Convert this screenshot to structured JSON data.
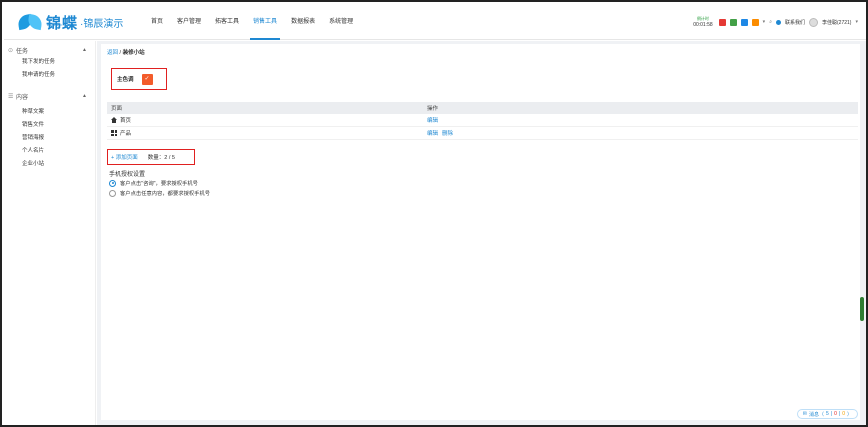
{
  "brand": {
    "name": "锦蝶",
    "suffix": "·锦辰演示",
    "url": "BEESM.COM"
  },
  "nav": [
    {
      "label": "首页",
      "active": false
    },
    {
      "label": "客户管理",
      "active": false
    },
    {
      "label": "拓客工具",
      "active": false
    },
    {
      "label": "销售工具",
      "active": true
    },
    {
      "label": "数据报表",
      "active": false
    },
    {
      "label": "系统管理",
      "active": false
    }
  ],
  "topright": {
    "timer_label": "倒计时",
    "timer_value": "00:01:58",
    "icons": [
      "red-square-icon",
      "green-square-icon",
      "blue-square-icon",
      "orange-square-icon"
    ],
    "contact": "联系我们",
    "user": "李佳聪(2721)"
  },
  "sidebar": {
    "groups": [
      {
        "label": "任务",
        "icon": "clock-icon",
        "items": [
          "我下发的任务",
          "我申请的任务"
        ]
      },
      {
        "label": "内容",
        "icon": "list-icon",
        "items": [
          "种草文案",
          "销售文件",
          "营销海报",
          "个人名片",
          "企业小站"
        ]
      }
    ]
  },
  "breadcrumb": {
    "link": "返回",
    "sep": " / ",
    "current": "装修小站"
  },
  "theme": {
    "label": "主色调",
    "color": "#f35c2b",
    "mark": "✓"
  },
  "table": {
    "headers": [
      "页面",
      "操作"
    ],
    "rows": [
      {
        "name": "首页",
        "icon": "home-icon",
        "ops": [
          "编辑"
        ]
      },
      {
        "name": "产品",
        "icon": "grid-icon",
        "ops": [
          "编辑",
          "删除"
        ]
      }
    ]
  },
  "add": {
    "label": "+ 添加页面",
    "count": "数量：2 / 5"
  },
  "auth": {
    "title": "手机授权设置",
    "options": [
      {
        "label": "客户点击\"咨询\"，要求授权手机号",
        "checked": true
      },
      {
        "label": "客户点击任意内容，都要求授权手机号",
        "checked": false
      }
    ]
  },
  "messages": {
    "label": "消息（",
    "a": "5",
    "sep1": " | ",
    "b": "0",
    "sep2": " | ",
    "c": "0",
    "end": " ）"
  }
}
